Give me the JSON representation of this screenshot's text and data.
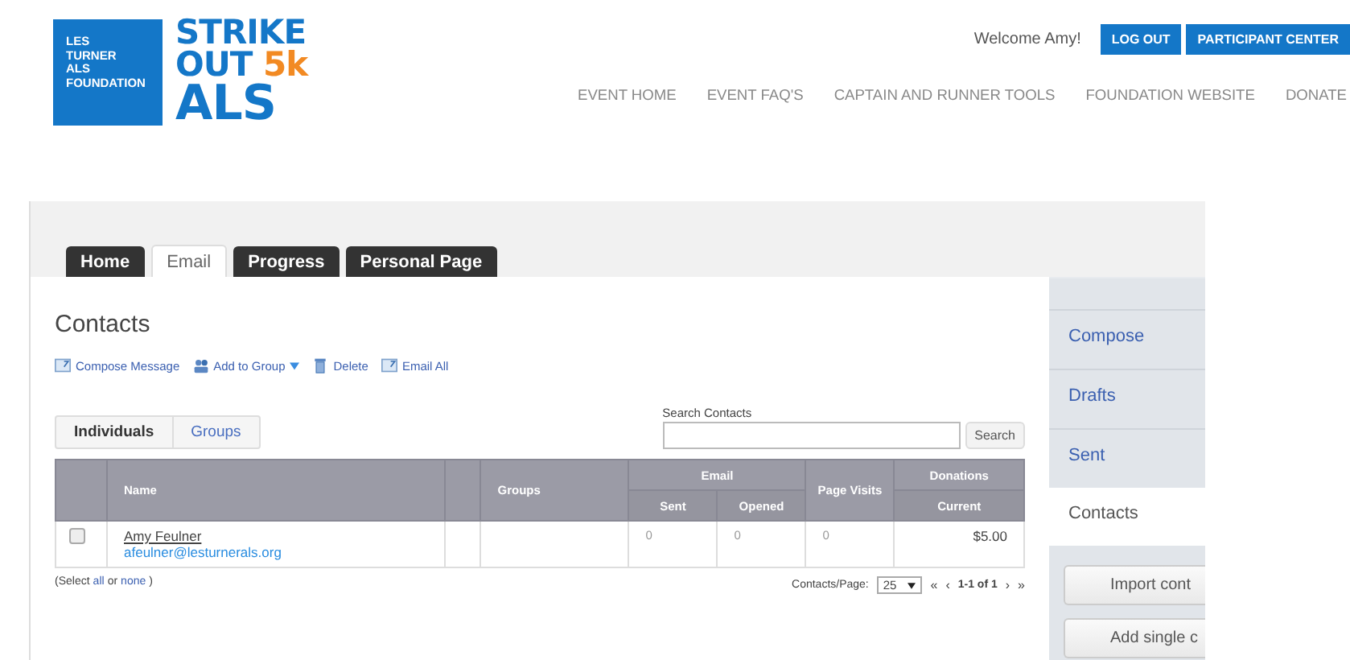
{
  "logo": {
    "org_lines": [
      "LES",
      "TURNER",
      "ALS",
      "FOUNDATION"
    ],
    "event_line_1": "STRIKE",
    "event_line_2": "OUT",
    "event_accent": "5k",
    "event_line_3": "ALS"
  },
  "header": {
    "welcome": "Welcome Amy!",
    "buttons": [
      "LOG OUT",
      "PARTICIPANT CENTER"
    ],
    "nav": [
      "EVENT HOME",
      "EVENT FAQ'S",
      "CAPTAIN AND RUNNER TOOLS",
      "FOUNDATION WEBSITE",
      "DONATE"
    ]
  },
  "tabs": [
    {
      "label": "Home",
      "selected": false
    },
    {
      "label": "Email",
      "selected": true
    },
    {
      "label": "Progress",
      "selected": false
    },
    {
      "label": "Personal Page",
      "selected": false
    }
  ],
  "heading": "Contacts",
  "actions": [
    {
      "kind": "compose",
      "label": "Compose Message"
    },
    {
      "kind": "group",
      "label": "Add to Group"
    },
    {
      "kind": "delete",
      "label": "Delete"
    },
    {
      "kind": "compose",
      "label": "Email All"
    }
  ],
  "view_toggle": [
    {
      "label": "Individuals",
      "selected": true
    },
    {
      "label": "Groups",
      "selected": false
    }
  ],
  "search": {
    "label": "Search Contacts",
    "button": "Search"
  },
  "table": {
    "headers": {
      "name": "Name",
      "groups": "Groups",
      "email": "Email",
      "sent": "Sent",
      "opened": "Opened",
      "page_visits": "Page Visits",
      "donations": "Donations",
      "current": "Current"
    },
    "rows": [
      {
        "checked": false,
        "name": "Amy Feulner",
        "email": "afeulner@lesturnerals.org",
        "sent": "0",
        "opened": "0",
        "page_visits": "0",
        "current": "$5.00"
      }
    ]
  },
  "select_note": {
    "prefix": "(Select",
    "all": "all",
    "or": "or",
    "none": "none",
    "suffix": ")"
  },
  "pager": {
    "label": "Contacts/Page:",
    "per_page": "25",
    "first": "«",
    "prev": "‹",
    "range": "1-1 of 1",
    "next": "›",
    "last": "»"
  },
  "sidebar": {
    "items": [
      {
        "label": "Compose",
        "selected": false
      },
      {
        "label": "Drafts",
        "selected": false
      },
      {
        "label": "Sent",
        "selected": false
      },
      {
        "label": "Contacts",
        "selected": true
      }
    ],
    "buttons": [
      "Import cont",
      "Add single c"
    ]
  }
}
